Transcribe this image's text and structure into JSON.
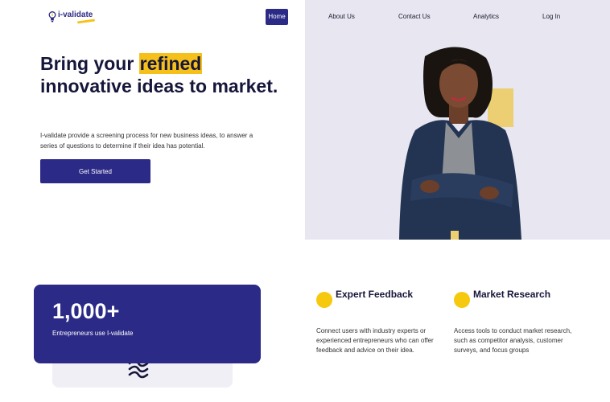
{
  "header": {
    "logo_text": "i-validate",
    "nav": [
      "Home",
      "About Us",
      "Contact Us",
      "Analytics",
      "Log In"
    ]
  },
  "hero": {
    "headline_before": "Bring your ",
    "headline_highlight": "refined",
    "headline_after": " innovative ideas to market.",
    "description": "I-validate provide a screening process for new business ideas, to answer a series of questions to determine if their idea has potential.",
    "cta_label": "Get Started"
  },
  "stats": {
    "number": "1,000+",
    "label": "Entrepreneurs use I-validate"
  },
  "features": [
    {
      "title": "Expert Feedback",
      "description": "Connect users with industry experts or experienced entrepreneurs who can offer feedback and advice on their idea."
    },
    {
      "title": "Market Research",
      "description": "Access tools to conduct market research, such as competitor analysis, customer surveys, and focus groups"
    }
  ],
  "colors": {
    "brand": "#2b2a86",
    "accent": "#f6c01a",
    "hero_panel": "#e7e6f1"
  }
}
